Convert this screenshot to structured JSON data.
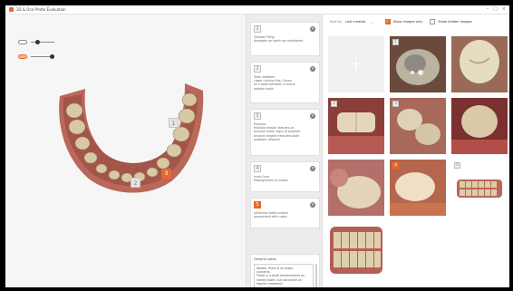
{
  "window": {
    "title": "3D & Oral Photo Evaluation",
    "minimize_glyph": "–",
    "maximize_glyph": "□",
    "close_glyph": "×"
  },
  "viewport": {
    "tools": [
      {
        "icon": "opacity-toggle-icon",
        "slider_value": 0.3
      },
      {
        "icon": "texture-toggle-icon",
        "slider_value": 0.9
      }
    ],
    "markers": [
      {
        "label": "1",
        "style": "gray"
      },
      {
        "label": "2",
        "style": "gray"
      },
      {
        "label": "3",
        "style": "orange"
      }
    ]
  },
  "notes": [
    {
      "num": "1",
      "active": false,
      "lines": [
        "Shallow Filling",
        "Amalgam on tooth not mentioned"
      ]
    },
    {
      "num": "2",
      "active": false,
      "lines": [
        "Tooth between",
        "Lower incisors fine, Crown",
        "on a tooth between in tissue",
        "wisdom tooth"
      ]
    },
    {
      "num": "3",
      "active": false,
      "lines": [
        "Erosions",
        "Multiple erosion features on",
        "occlusal areas, signs of possible",
        "bruxism related fractured tooth",
        "quadrant affected"
      ]
    },
    {
      "num": "4",
      "active": false,
      "lines": [
        "Inner Gear",
        "Misalignment on molars"
      ]
    },
    {
      "num": "5",
      "active": true,
      "lines": [
        "advanced tooth-surface",
        "assessment with notes"
      ]
    }
  ],
  "general_notes": {
    "title": "General notes",
    "lines": [
      "Steady, there is no major",
      "concerns.",
      "There is a small enhancement on",
      "nearby tooth, but not active on",
      "regular treatment."
    ]
  },
  "images_toolbar": {
    "sort_label": "Sort by",
    "sort_value": "Last created",
    "sort_chevron": "⌄",
    "show_images_label": "Show images only",
    "show_images_checked": true,
    "show_hidden_label": "Show hidden images",
    "show_hidden_checked": false
  },
  "image_tiles": [
    {
      "kind": "add",
      "badge": ""
    },
    {
      "kind": "photo-1",
      "badge": "1"
    },
    {
      "kind": "photo-2",
      "badge": ""
    },
    {
      "kind": "photo-3",
      "badge": "2"
    },
    {
      "kind": "photo-4",
      "badge": "3"
    },
    {
      "kind": "photo-5",
      "badge": ""
    },
    {
      "kind": "photo-6",
      "badge": ""
    },
    {
      "kind": "photo-7",
      "badge": "4"
    },
    {
      "kind": "scan-1",
      "badge": "5"
    },
    {
      "kind": "scan-2",
      "badge": ""
    }
  ],
  "colors": {
    "accent": "#e8692a",
    "gum": "#b9685b",
    "tooth": "#d8c9a4"
  }
}
